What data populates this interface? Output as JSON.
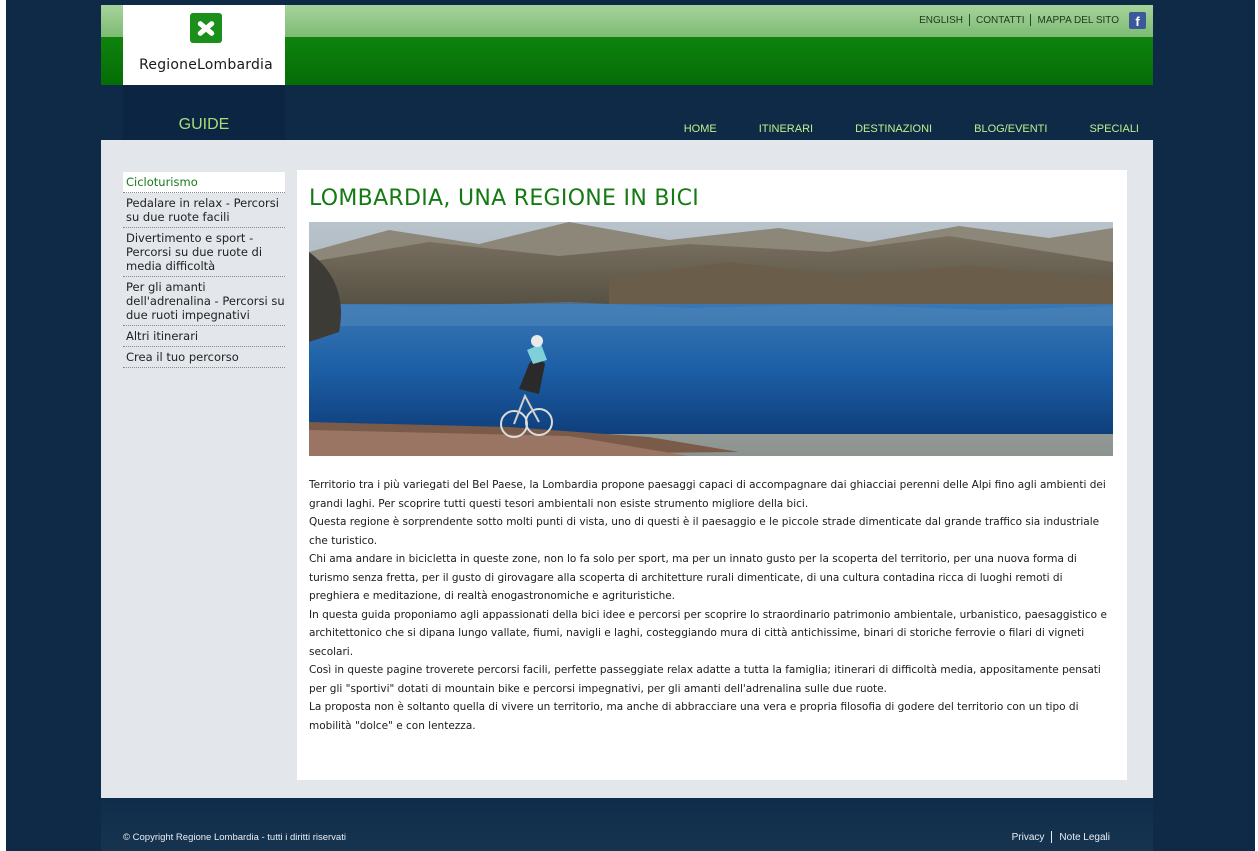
{
  "header": {
    "logo_text": "RegioneLombardia",
    "links": [
      "ENGLISH",
      "CONTATTI",
      "MAPPA DEL SITO"
    ],
    "facebook_label": "f"
  },
  "section_tab": "GUIDE",
  "nav": [
    "HOME",
    "ITINERARI",
    "DESTINAZIONI",
    "BLOG/EVENTI",
    "SPECIALI"
  ],
  "sidebar": {
    "items": [
      {
        "label": "Cicloturismo",
        "active": true
      },
      {
        "label": "Pedalare in relax - Percorsi su due ruote facili"
      },
      {
        "label": "Divertimento e sport - Percorsi su due ruote di media difficoltà"
      },
      {
        "label": "Per gli amanti dell'adrenalina - Percorsi su due ruoti impegnativi"
      },
      {
        "label": "Altri itinerari"
      },
      {
        "label": "Crea il tuo percorso"
      }
    ]
  },
  "main": {
    "title": "LOMBARDIA, UNA REGIONE IN BICI",
    "paragraphs": [
      "Territorio tra i più variegati del Bel Paese, la Lombardia propone paesaggi capaci di accompagnare dai ghiacciai perenni delle Alpi fino agli ambienti dei grandi laghi. Per scoprire tutti questi tesori ambientali non esiste strumento migliore della bici.",
      "Questa regione è sorprendente sotto molti punti di vista, uno di questi è il paesaggio e le piccole strade dimenticate dal grande traffico sia industriale che turistico.",
      "Chi ama andare in bicicletta in queste zone, non lo fa solo per sport, ma per un innato gusto per la scoperta del territorio, per una nuova forma di turismo senza fretta, per il gusto di girovagare alla scoperta di architetture rurali dimenticate, di una cultura contadina ricca di luoghi remoti di preghiera e meditazione, di realtà enogastronomiche e agrituristiche.",
      "In questa guida proponiamo agli appassionati della bici idee e percorsi per scoprire lo straordinario patrimonio ambientale, urbanistico, paesaggistico e architettonico che si dipana lungo vallate, fiumi, navigli e laghi, costeggiando mura di città antichissime, binari di storiche ferrovie o filari di vigneti secolari.",
      "Così in queste pagine troverete percorsi facili, perfette passeggiate relax adatte a tutta la famiglia; itinerari di difficoltà media, appositamente pensati per gli \"sportivi\" dotati di mountain bike e percorsi impegnativi, per gli amanti dell'adrenalina sulle due ruote.",
      "La proposta non è soltanto quella di vivere un territorio, ma anche di abbracciare una vera e propria filosofia di godere del territorio con un tipo di mobilità \"dolce\" e con lentezza."
    ]
  },
  "footer": {
    "copyright": "© Copyright Regione Lombardia - tutti i diritti riservati",
    "links": [
      "Privacy",
      "Note Legali"
    ]
  },
  "colors": {
    "brand_green": "#0a7a0a",
    "title_green": "#147a14",
    "nav_text": "#bff08e",
    "page_bg": "#0e2a47",
    "content_bg": "#e3e6eb"
  }
}
